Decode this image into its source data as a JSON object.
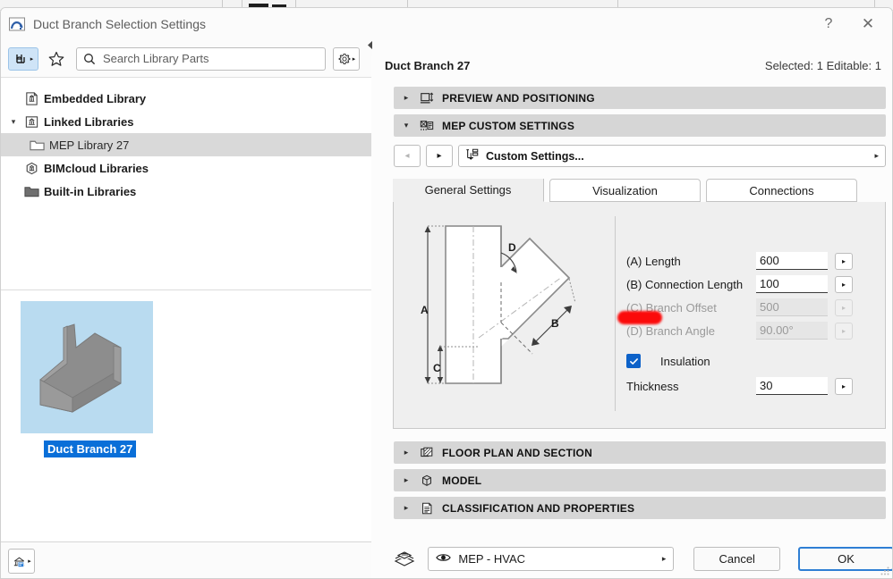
{
  "window": {
    "title": "Duct Branch Selection Settings",
    "title_icon": "archicad-object-icon",
    "help_label": "?",
    "close_label": "✕"
  },
  "library_browser": {
    "browse_icon": "furniture-browse-icon",
    "favorites_icon": "star-icon",
    "search": {
      "icon": "search-icon",
      "placeholder": "Search Library Parts",
      "value": ""
    },
    "settings_icon": "gear-icon",
    "tree": [
      {
        "label": "Embedded Library",
        "icon": "embedded-library-icon",
        "twist": "",
        "selected": false,
        "indent": false
      },
      {
        "label": "Linked Libraries",
        "icon": "linked-library-icon",
        "twist": "▾",
        "selected": false,
        "indent": false
      },
      {
        "label": "MEP Library 27",
        "icon": "folder-icon",
        "twist": "",
        "selected": true,
        "indent": true
      },
      {
        "label": "BIMcloud Libraries",
        "icon": "bimcloud-library-icon",
        "twist": "",
        "selected": false,
        "indent": false
      },
      {
        "label": "Built-in Libraries",
        "icon": "builtin-library-icon",
        "twist": "",
        "selected": false,
        "indent": false
      }
    ],
    "preview": {
      "item_label": "Duct Branch 27",
      "thumbnail_bg": "#b9dbf0",
      "model_color": "#8a8a8a"
    },
    "library_manager_icon": "library-manager-icon",
    "collapse_icon": "collapse-left-icon"
  },
  "object": {
    "name": "Duct Branch 27",
    "selection_info": "Selected: 1 Editable: 1"
  },
  "sections": [
    {
      "id": "preview-positioning",
      "title": "PREVIEW AND POSITIONING",
      "icon": "preview-positioning-icon",
      "expanded": false,
      "arrow": "▸"
    },
    {
      "id": "mep-custom-settings",
      "title": "MEP CUSTOM SETTINGS",
      "icon": "mep-settings-icon",
      "expanded": true,
      "arrow": "▾"
    },
    {
      "id": "floor-plan-section",
      "title": "FLOOR PLAN AND SECTION",
      "icon": "floor-plan-icon",
      "expanded": false,
      "arrow": "▸"
    },
    {
      "id": "model",
      "title": "MODEL",
      "icon": "cube-icon",
      "expanded": false,
      "arrow": "▸"
    },
    {
      "id": "classification-properties",
      "title": "CLASSIFICATION AND PROPERTIES",
      "icon": "document-icon",
      "expanded": false,
      "arrow": "▸"
    }
  ],
  "custom_settings_row": {
    "prev_label": "◂",
    "next_label": "▸",
    "icon": "custom-settings-icon",
    "label": "Custom Settings...",
    "caret": "▸",
    "prev_enabled": false,
    "next_enabled": true
  },
  "tabs": [
    {
      "id": "general-settings",
      "label": "General Settings",
      "active": true
    },
    {
      "id": "visualization",
      "label": "Visualization",
      "active": false
    },
    {
      "id": "connections",
      "label": "Connections",
      "active": false
    }
  ],
  "diagram": {
    "labels": {
      "a": "A",
      "b": "B",
      "c": "C",
      "d": "D"
    },
    "alt": "duct-branch-dimension-diagram"
  },
  "parameters": [
    {
      "id": "length",
      "label": "(A) Length",
      "value": "600",
      "enabled": true
    },
    {
      "id": "connection-length",
      "label": "(B) Connection Length",
      "value": "100",
      "enabled": true
    },
    {
      "id": "branch-offset",
      "label": "(C) Branch Offset",
      "value": "500",
      "enabled": false
    },
    {
      "id": "branch-angle",
      "label": "(D) Branch Angle",
      "value": "90.00°",
      "enabled": false
    }
  ],
  "insulation": {
    "checkbox_label": "Insulation",
    "checked": true,
    "checkmark": "✓",
    "thickness_label": "Thickness",
    "thickness_value": "30",
    "thickness_enabled": true
  },
  "annotation": {
    "type": "red-highlight-mark",
    "color": "#fb0a0a"
  },
  "footer": {
    "layers_icon": "layers-icon",
    "eye_icon": "eye-icon",
    "layer_value": "MEP - HVAC",
    "layer_caret": "▸",
    "cancel_label": "Cancel",
    "ok_label": "OK"
  },
  "colors": {
    "accent_blue": "#0d62c9",
    "ok_border": "#2f7fd4",
    "section_bar": "#d6d6d6",
    "selection": "#d9d9d9"
  }
}
